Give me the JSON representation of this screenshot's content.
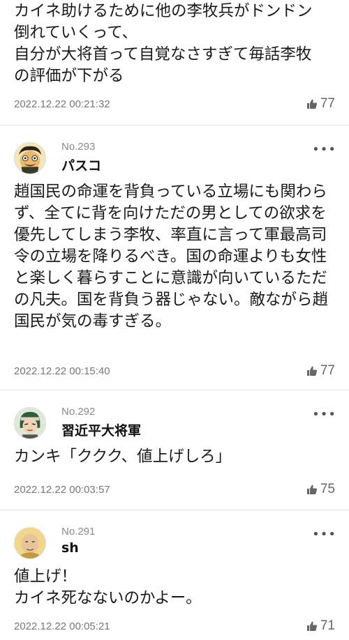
{
  "comments": [
    {
      "number": "",
      "author": "",
      "text": "カイネ助けるために他の李牧兵がドンドン倒れていくって、\n自分が大将首って自覚なさすぎて毎話李牧の評価が下がる",
      "timestamp": "2022.12.22 00:21:32",
      "likes": "77"
    },
    {
      "number": "No.293",
      "author": "パスコ",
      "avatar_icon": "cartoon-face-avatar",
      "text": "趙国民の命運を背負っている立場にも関わらず、全てに背を向けただの男としての欲求を優先してしまう李牧、率直に言って軍最高司令の立場を降りるべき。国の命運よりも女性と楽しく暮らすことに意識が向いているただの凡夫。国を背負う器じゃない。敵ながら趙国民が気の毒すぎる。",
      "timestamp": "2022.12.22 00:15:40",
      "likes": "77"
    },
    {
      "number": "No.292",
      "author": "習近平大将軍",
      "avatar_icon": "anime-character-avatar",
      "text": "カンキ「ククク、値上げしろ」",
      "timestamp": "2022.12.22 00:03:57",
      "likes": "75"
    },
    {
      "number": "No.291",
      "author": "sh",
      "avatar_icon": "bald-man-avatar",
      "text": "値上げ！\nカイネ死なないのかよー。",
      "timestamp": "2022.12.22 00:05:21",
      "likes": "71"
    }
  ],
  "more_label": "•••",
  "colors": {
    "divider": "#e4e4e4",
    "meta": "#777777"
  }
}
